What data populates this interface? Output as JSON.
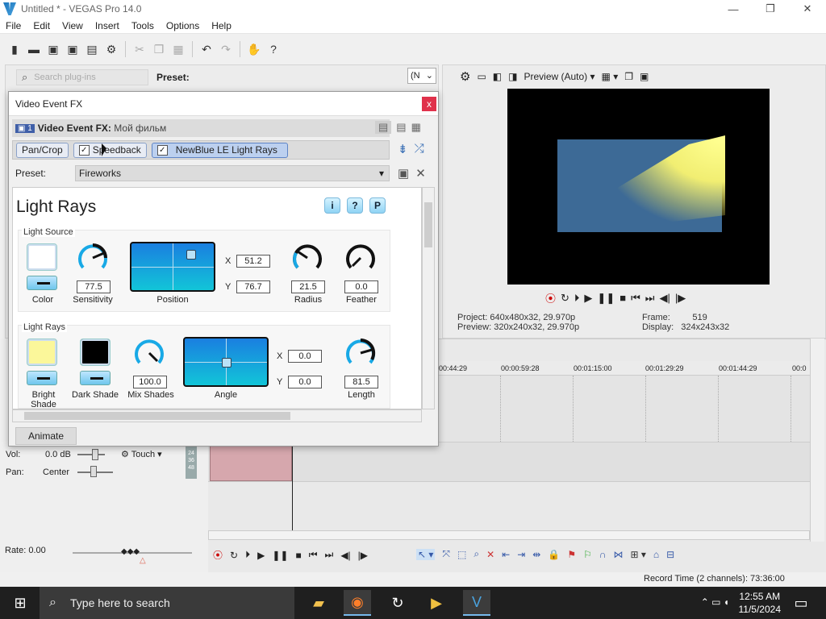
{
  "window": {
    "title": "Untitled * - VEGAS Pro 14.0",
    "min": "—",
    "max": "❐",
    "close": "✕"
  },
  "menu": [
    "File",
    "Edit",
    "View",
    "Insert",
    "Tools",
    "Options",
    "Help"
  ],
  "explorer": {
    "search_placeholder": "Search plug-ins",
    "preset_label": "Preset:",
    "dropdown_value": "(N"
  },
  "fx": {
    "title": "Video Event FX",
    "close": "x",
    "track_num": "1",
    "header_label": "Video Event FX:",
    "header_value": "Мой фильм",
    "chain": [
      "Pan/Crop",
      "Speedback",
      "NewBlue LE Light Rays"
    ],
    "preset_label": "Preset:",
    "preset_value": "Fireworks",
    "plugin_title": "Light Rays",
    "help_buttons": [
      "i",
      "?",
      "P"
    ],
    "light_source": {
      "label": "Light Source",
      "color_label": "Color",
      "sensitivity": "77.5",
      "sensitivity_label": "Sensitivity",
      "position_label": "Position",
      "x_label": "X",
      "x": "51.2",
      "y_label": "Y",
      "y": "76.7",
      "radius": "21.5",
      "radius_label": "Radius",
      "feather": "0.0",
      "feather_label": "Feather",
      "color": "#ffffff"
    },
    "light_rays": {
      "label": "Light Rays",
      "bright_label": "Bright Shade",
      "bright_color": "#fbf79a",
      "dark_label": "Dark Shade",
      "dark_color": "#000000",
      "mix": "100.0",
      "mix_label": "Mix Shades",
      "angle_label": "Angle",
      "x_label": "X",
      "x": "0.0",
      "y_label": "Y",
      "y": "0.0",
      "length": "81.5",
      "length_label": "Length"
    },
    "animate": "Animate"
  },
  "preview": {
    "mode": "Preview (Auto)",
    "project_label": "Project:",
    "project": "640x480x32, 29.970p",
    "preview_label": "Preview:",
    "preview": "320x240x32, 29.970p",
    "frame_label": "Frame:",
    "frame": "519",
    "display_label": "Display:",
    "display": "324x243x32"
  },
  "timeline": {
    "ticks": [
      "00:44:29",
      "00:00:59:28",
      "00:01:15:00",
      "00:01:29:29",
      "00:01:44:29",
      "00:0"
    ],
    "vol_label": "Vol:",
    "vol": "0.0 dB",
    "touch": "Touch",
    "pan_label": "Pan:",
    "pan": "Center",
    "rate": "Rate: 0.00",
    "meter": [
      "24",
      "36",
      "48"
    ],
    "record_time": "Record Time (2 channels): 73:36:00"
  },
  "taskbar": {
    "search": "Type here to search",
    "time": "12:55 AM",
    "date": "11/5/2024"
  }
}
